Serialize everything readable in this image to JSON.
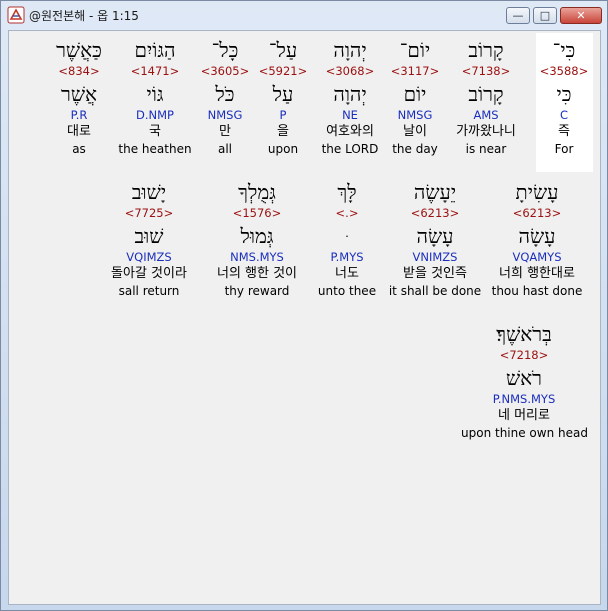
{
  "window": {
    "title": "@원전본해 - 옵 1:15",
    "controls": {
      "minimize": "—",
      "maximize": "□",
      "close": "✕"
    }
  },
  "words": [
    {
      "heb": "כִּי־",
      "num": "<3588>",
      "lemma": "כִּי",
      "parse": "C",
      "kor": "즉",
      "eng": "For"
    },
    {
      "heb": "קָרוֹב",
      "num": "<7138>",
      "lemma": "קָרוֹב",
      "parse": "AMS",
      "kor": "가까왔나니",
      "eng": "is near"
    },
    {
      "heb": "יוֹם־",
      "num": "<3117>",
      "lemma": "יוֹם",
      "parse": "NMSG",
      "kor": "날이",
      "eng": "the day"
    },
    {
      "heb": "יְהוָה",
      "num": "<3068>",
      "lemma": "יְהוָה",
      "parse": "NE",
      "kor": "여호와의",
      "eng": "the LORD"
    },
    {
      "heb": "עַל־",
      "num": "<5921>",
      "lemma": "עַל",
      "parse": "P",
      "kor": "을",
      "eng": "upon"
    },
    {
      "heb": "כָּל־",
      "num": "<3605>",
      "lemma": "כֹּל",
      "parse": "NMSG",
      "kor": "만",
      "eng": "all"
    },
    {
      "heb": "הַגּוֹיִם",
      "num": "<1471>",
      "lemma": "גּוֹי",
      "parse": "D.NMP",
      "kor": "국",
      "eng": "the heathen"
    },
    {
      "heb": "כַּאֲשֶׁר",
      "num": "<834>",
      "lemma": "אֲשֶׁר",
      "parse": "P.R",
      "kor": "대로",
      "eng": "as"
    },
    {
      "heb": "עָשִׂיתָ",
      "num": "<6213>",
      "lemma": "עָשָׂה",
      "parse": "VQAMYS",
      "kor": "너희 행한대로",
      "eng": "thou hast done"
    },
    {
      "heb": "יֵעָשֶׂה",
      "num": "<6213>",
      "lemma": "עָשָׂה",
      "parse": "VNIMZS",
      "kor": "받을 것인즉",
      "eng": "it shall be done"
    },
    {
      "heb": "לָּךְ",
      "num": "<.>",
      "lemma": "ּ",
      "parse": "P.MYS",
      "kor": "너도",
      "eng": "unto thee"
    },
    {
      "heb": "גְּמֻלְךָ",
      "num": "<1576>",
      "lemma": "גְּמוּל",
      "parse": "NMS.MYS",
      "kor": "너의 행한 것이",
      "eng": "thy reward"
    },
    {
      "heb": "יָשׁוּב",
      "num": "<7725>",
      "lemma": "שׁוּב",
      "parse": "VQIMZS",
      "kor": "돌아갈 것이라",
      "eng": "sall return"
    },
    {
      "heb": "בְּרֹאשֶׁךָ׃",
      "num": "<7218>",
      "lemma": "רֹאשׁ",
      "parse": "P.NMS.MYS",
      "kor": "네 머리로",
      "eng": "upon thine own head"
    }
  ]
}
